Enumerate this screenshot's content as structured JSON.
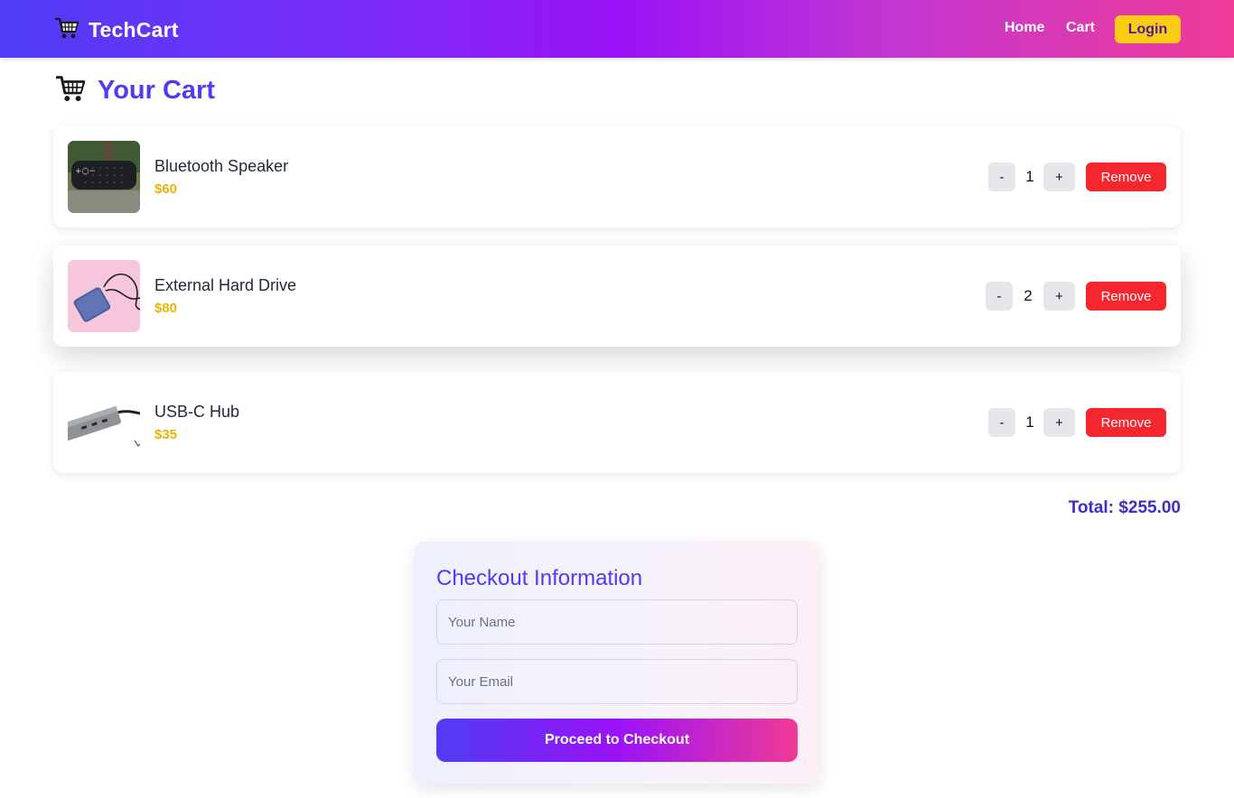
{
  "nav": {
    "brand": "TechCart",
    "links": [
      {
        "label": "Home"
      },
      {
        "label": "Cart"
      }
    ],
    "login_label": "Login"
  },
  "page": {
    "title": "Your Cart"
  },
  "cart": {
    "items": [
      {
        "name": "Bluetooth Speaker",
        "price": "$60",
        "qty": "1",
        "image": "bluetooth-speaker-photo"
      },
      {
        "name": "External Hard Drive",
        "price": "$80",
        "qty": "2",
        "image": "external-hard-drive-photo"
      },
      {
        "name": "USB-C Hub",
        "price": "$35",
        "qty": "1",
        "image": "usb-c-hub-photo"
      }
    ],
    "decrement_label": "-",
    "increment_label": "+",
    "remove_label": "Remove",
    "total_label": "Total: $255.00"
  },
  "checkout": {
    "title": "Checkout Information",
    "name_placeholder": "Your Name",
    "email_placeholder": "Your Email",
    "submit_label": "Proceed to Checkout"
  },
  "colors": {
    "accent": "#4f3cf5",
    "price": "#eab308",
    "remove": "#f4262e",
    "login": "#facc15"
  }
}
